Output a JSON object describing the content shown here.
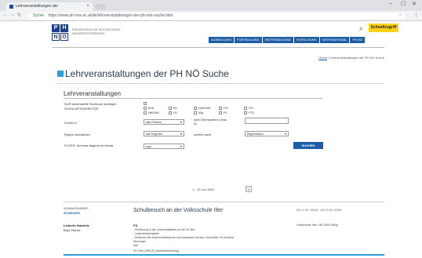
{
  "browser": {
    "tab_title": "Lehrveranstaltungen der",
    "url_security": "Sicher",
    "url": "https://www.ph-noe.ac.at/de/lehrveranstaltungen-der-ph-noe-suche.html",
    "min": "–",
    "max": "☐",
    "close": "✕"
  },
  "header": {
    "logo_letters": [
      "P",
      "H",
      "N",
      "Ö"
    ],
    "logo_text_line1": "PÄDAGOGISCHE HOCHSCHULE",
    "logo_text_line2": "NIEDERÖSTERREICH",
    "schnellzugriff": "Schnellzugriff",
    "nav": [
      "AUSBILDUNG",
      "FORTBILDUNG",
      "WEITERBILDUNG",
      "FORSCHUNG",
      "INTERNATIONAL",
      "PH NÖ"
    ]
  },
  "breadcrumb": {
    "home": "Home",
    "current": "/ Lehrveranstaltungen der PH NÖ Suche"
  },
  "page_title": "Lehrveranstaltungen der PH NÖ Suche",
  "section_title": "Lehrveranstaltungen",
  "form": {
    "label_nur": "NUR landesweite Seminare anzeigen",
    "label_schulart": "SCHULARTENSEKTOR",
    "schularten": [
      "AHS",
      "BS",
      "HAK/HAS",
      "HTL",
      "HTL",
      "NMS/NS",
      "VS",
      "Allg.",
      "FS",
      "PTS"
    ],
    "label_suche": "Suche in",
    "suche_value": "allen Feldern",
    "label_nach": "nach Stichwörtern (max. 3)",
    "label_region": "Region auswählen",
    "region_value": "alle Regionen",
    "label_sortiert": "sortiert nach",
    "sortiert_value": "Beginndatum",
    "label_filter": "FILTER: Seminar beginnt im Monat",
    "filter_value": "egal",
    "suchen": "SUCHEN"
  },
  "pager": {
    "text": "1 - 10 von 1602",
    "next": "»"
  },
  "event": {
    "code_label": "SEMINARNUMMER",
    "code": "3718SLE01",
    "title": "Schulbesuch an der Volksschule Ilter",
    "date": "09.17.04. 2018 - 09.17.04. 2018",
    "person1": "Lieberth Gabriele",
    "person2": "Bayr Patrick",
    "head": "PÄ",
    "lines": [
      "- Einführung in die Unterrichtsarbeit an der VS Itter",
      "- Unterrichtsbeispiele",
      "- Reflexion der Unterrichtsbesuche und Austausch mit dem Schulleiter VD Andreas",
      "Wurzinger",
      "###"
    ],
    "location": "Volksschule, Itter 146, 6300 Wörgl",
    "type": "SS (Tele-LBR) [E] [Schulentwicklung]"
  }
}
